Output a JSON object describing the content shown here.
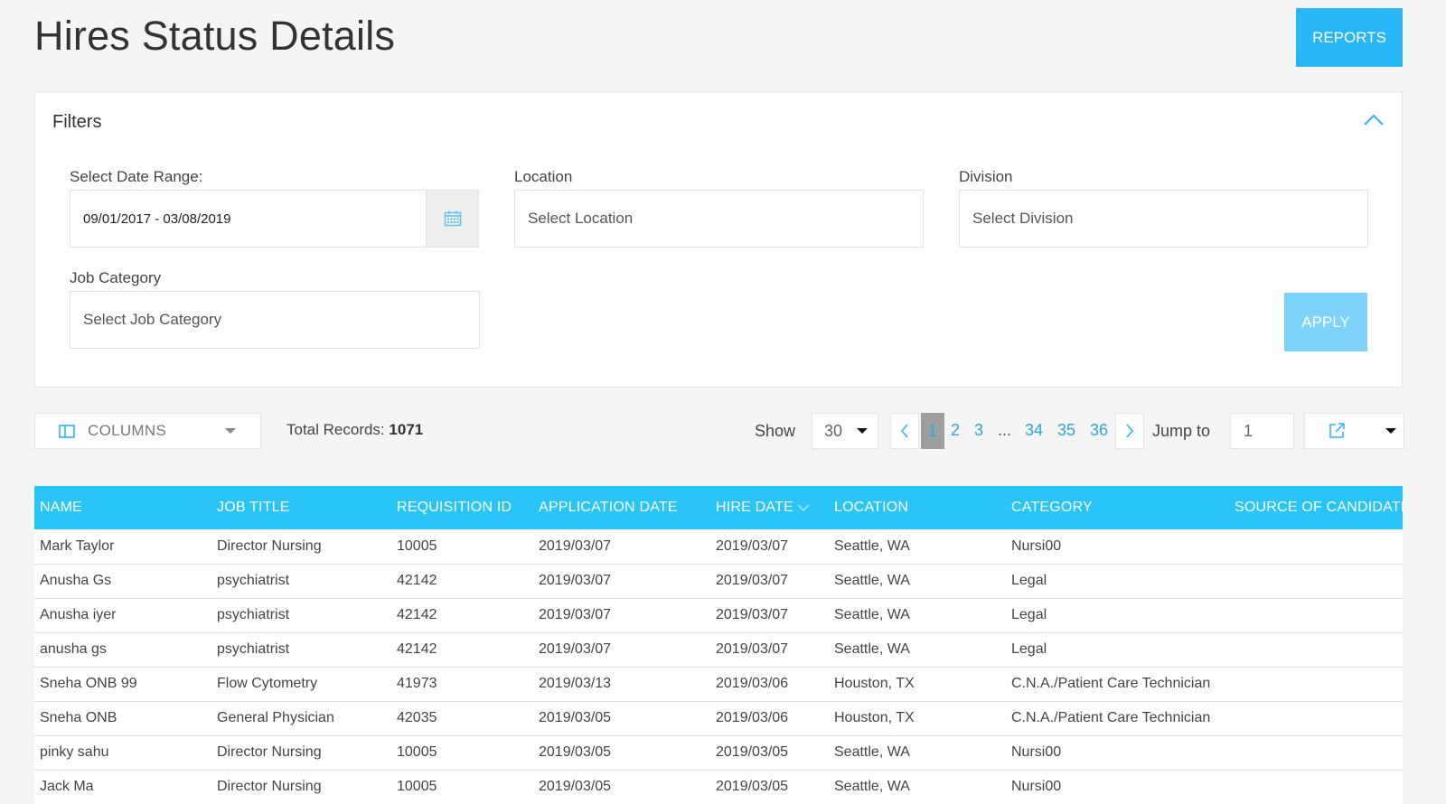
{
  "header": {
    "title": "Hires Status Details",
    "reports_label": "REPORTS"
  },
  "filters": {
    "title": "Filters",
    "date_range": {
      "label": "Select Date Range:",
      "value": "09/01/2017 - 03/08/2019"
    },
    "location": {
      "label": "Location",
      "placeholder": "Select Location"
    },
    "division": {
      "label": "Division",
      "placeholder": "Select Division"
    },
    "job_category": {
      "label": "Job Category",
      "placeholder": "Select Job Category"
    },
    "apply_label": "APPLY"
  },
  "toolbar": {
    "columns_label": "COLUMNS",
    "total_records_label": "Total Records:",
    "total_records_value": "1071",
    "show_label": "Show",
    "show_value": "30",
    "pages": [
      "2",
      "3",
      "34",
      "35",
      "36"
    ],
    "current_page": "1",
    "ellipsis": "...",
    "jump_label": "Jump to",
    "jump_value": "1"
  },
  "table": {
    "columns": [
      "NAME",
      "JOB TITLE",
      "REQUISITION ID",
      "APPLICATION DATE",
      "HIRE DATE",
      "LOCATION",
      "CATEGORY",
      "SOURCE OF CANDIDATE"
    ],
    "rows": [
      [
        "Mark Taylor",
        "Director Nursing",
        "10005",
        "2019/03/07",
        "2019/03/07",
        "Seattle, WA",
        "Nursi00",
        ""
      ],
      [
        "Anusha Gs",
        "psychiatrist",
        "42142",
        "2019/03/07",
        "2019/03/07",
        "Seattle, WA",
        "Legal",
        ""
      ],
      [
        "Anusha iyer",
        "psychiatrist",
        "42142",
        "2019/03/07",
        "2019/03/07",
        "Seattle, WA",
        "Legal",
        ""
      ],
      [
        "anusha gs",
        "psychiatrist",
        "42142",
        "2019/03/07",
        "2019/03/07",
        "Seattle, WA",
        "Legal",
        ""
      ],
      [
        "Sneha ONB 99",
        "Flow Cytometry",
        "41973",
        "2019/03/13",
        "2019/03/06",
        "Houston, TX",
        "C.N.A./Patient Care Technician",
        ""
      ],
      [
        "Sneha ONB",
        "General Physician",
        "42035",
        "2019/03/05",
        "2019/03/06",
        "Houston, TX",
        "C.N.A./Patient Care Technician",
        ""
      ],
      [
        "pinky sahu",
        "Director Nursing",
        "10005",
        "2019/03/05",
        "2019/03/05",
        "Seattle, WA",
        "Nursi00",
        ""
      ],
      [
        "Jack Ma",
        "Director Nursing",
        "10005",
        "2019/03/05",
        "2019/03/05",
        "Seattle, WA",
        "Nursi00",
        ""
      ]
    ]
  },
  "colors": {
    "accent": "#29b6f6",
    "table_header": "#29c4f8",
    "apply_disabled": "#7dd3fa",
    "link": "#29a8e0"
  },
  "icons": [
    "calendar-icon",
    "chevron-up-icon",
    "columns-icon",
    "caret-down-icon",
    "chevron-left-icon",
    "chevron-right-icon",
    "external-link-icon",
    "sort-desc-icon"
  ]
}
